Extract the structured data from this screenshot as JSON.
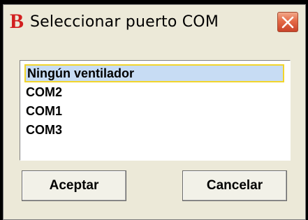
{
  "window": {
    "title": "Seleccionar puerto COM",
    "app_icon_letter": "B",
    "icon_color": "#d21f1f"
  },
  "port_list": {
    "items": [
      {
        "label": "Ningún ventilador",
        "selected": true
      },
      {
        "label": "COM2",
        "selected": false
      },
      {
        "label": "COM1",
        "selected": false
      },
      {
        "label": "COM3",
        "selected": false
      }
    ]
  },
  "buttons": {
    "accept_label": "Aceptar",
    "cancel_label": "Cancelar"
  },
  "colors": {
    "selection_background": "#c7dcf4",
    "selection_border": "#f2d52c",
    "close_button": "#e46a46"
  }
}
